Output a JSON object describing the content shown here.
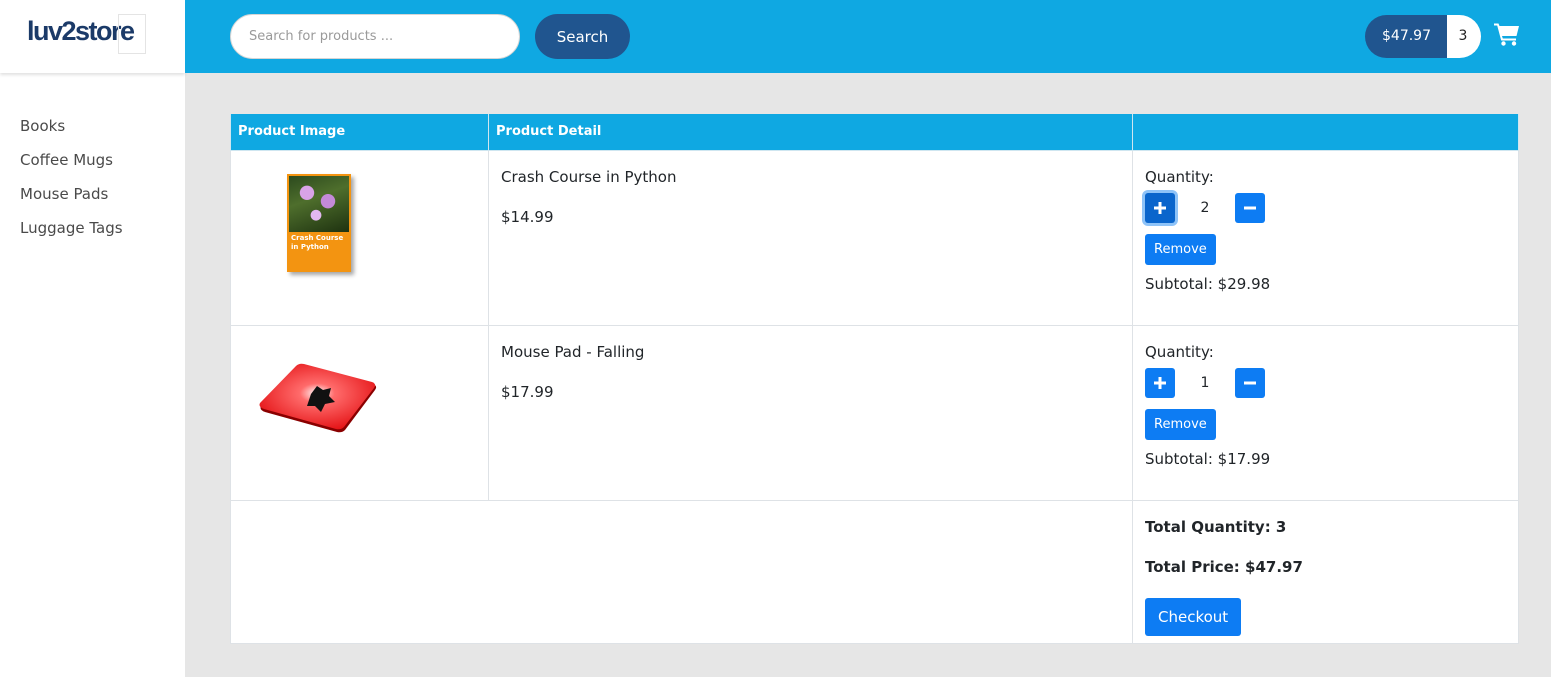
{
  "brand": {
    "logo_text": "luv2store"
  },
  "sidebar": {
    "items": [
      {
        "label": "Books"
      },
      {
        "label": "Coffee Mugs"
      },
      {
        "label": "Mouse Pads"
      },
      {
        "label": "Luggage Tags"
      }
    ]
  },
  "header": {
    "search_placeholder": "Search for products ...",
    "search_button": "Search",
    "cart_total": "$47.97",
    "cart_quantity": "3",
    "cart_icon": "shopping-cart-icon"
  },
  "table": {
    "headers": [
      "Product Image",
      "Product Detail",
      ""
    ],
    "items": [
      {
        "name": "Crash Course in Python",
        "price": "$14.99",
        "quantity_label": "Quantity:",
        "quantity": "2",
        "remove_label": "Remove",
        "subtotal": "Subtotal: $29.98",
        "image_icon": "book-cover-image",
        "image_text": "Crash Course in Python"
      },
      {
        "name": "Mouse Pad - Falling",
        "price": "$17.99",
        "quantity_label": "Quantity:",
        "quantity": "1",
        "remove_label": "Remove",
        "subtotal": "Subtotal: $17.99",
        "image_icon": "mouse-pad-image"
      }
    ],
    "summary": {
      "total_quantity": "Total Quantity: 3",
      "total_price": "Total Price: $47.97",
      "checkout_label": "Checkout"
    }
  },
  "colors": {
    "header_bg": "#0fa8e2",
    "dark_button": "#20558f",
    "primary_button": "#0d7cf3",
    "page_bg": "#e6e6e6"
  }
}
